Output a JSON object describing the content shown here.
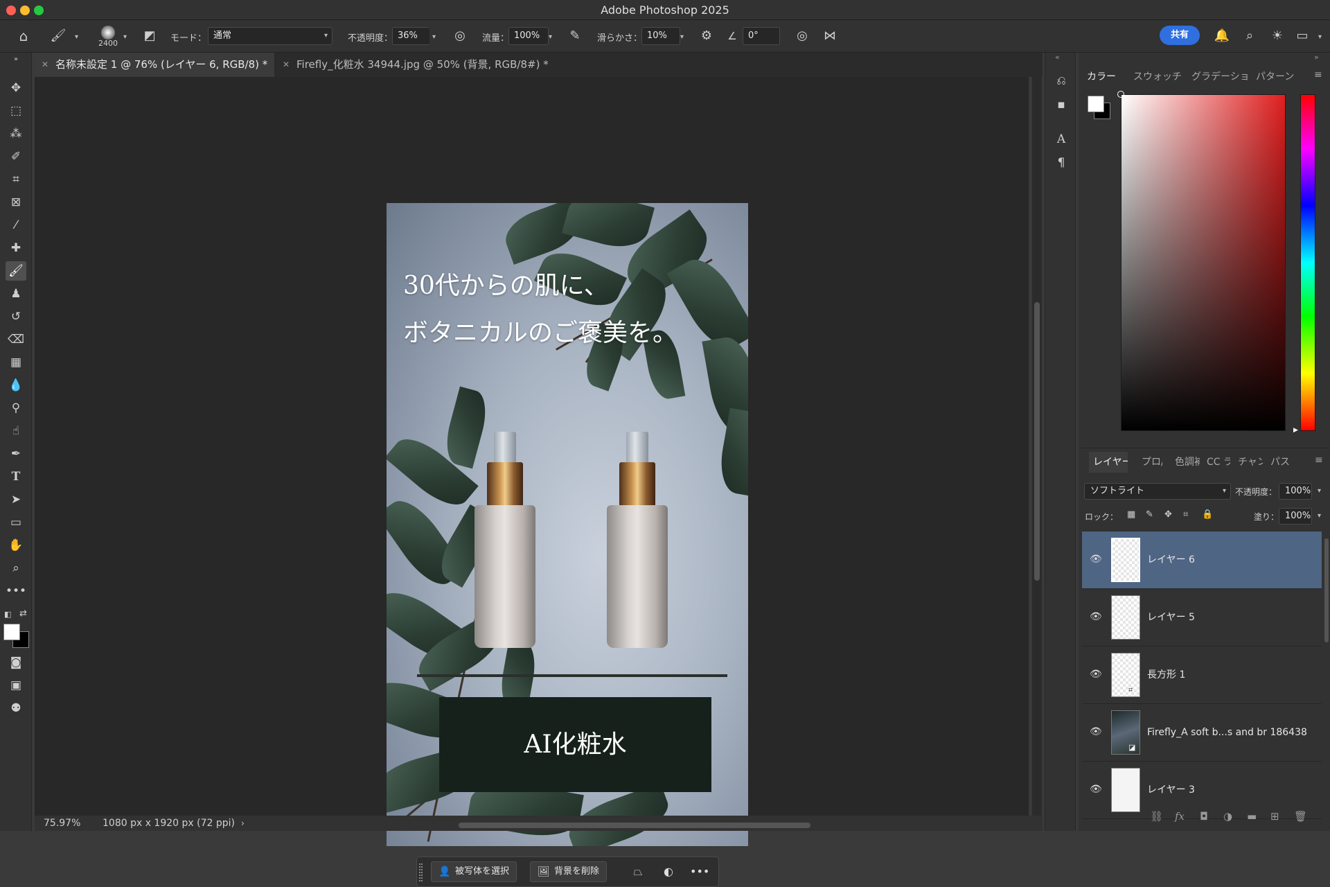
{
  "window": {
    "title": "Adobe Photoshop 2025"
  },
  "options": {
    "brush_size": "2400",
    "mode_label": "モード：",
    "mode_value": "通常",
    "opacity_label": "不透明度：",
    "opacity_value": "36%",
    "flow_label": "流量：",
    "flow_value": "100%",
    "smoothing_label": "滑らかさ：",
    "smoothing_value": "10%",
    "angle_value": "0°",
    "share_label": "共有"
  },
  "tabs": [
    {
      "label": "名称未設定 1 @ 76% (レイヤー 6, RGB/8) *"
    },
    {
      "label": "Firefly_化粧水 34944.jpg @ 50% (背景, RGB/8#) *"
    }
  ],
  "canvas": {
    "headline_line1": "30代からの肌に、",
    "headline_line2": "ボタニカルのご褒美を。",
    "product_name": "AI化粧水"
  },
  "context_bar": {
    "select_subject": "被写体を選択",
    "remove_background": "背景を削除"
  },
  "status": {
    "zoom": "75.97%",
    "doc_info": "1080 px x 1920 px (72 ppi)"
  },
  "color_panel": {
    "tabs": [
      "カラー",
      "スウォッチ",
      "グラデーショ",
      "パターン"
    ]
  },
  "layers_panel": {
    "tabs": [
      "レイヤー",
      "プロ/",
      "色調補",
      "CC ラ",
      "チャン",
      "パス"
    ],
    "blend_mode": "ソフトライト",
    "opacity_label": "不透明度：",
    "opacity_value": "100%",
    "lock_label": "ロック：",
    "fill_label": "塗り：",
    "fill_value": "100%",
    "layers": [
      {
        "name": "レイヤー 6"
      },
      {
        "name": "レイヤー 5"
      },
      {
        "name": "長方形 1"
      },
      {
        "name": "Firefly_A soft b...s and br 186438"
      },
      {
        "name": "レイヤー 3"
      }
    ]
  },
  "icons": [
    "home-icon",
    "brush-icon",
    "airbrush-icon",
    "gear-icon",
    "bell-icon",
    "search-icon",
    "lightbulb-icon",
    "workspace-icon",
    "eye-icon",
    "link-icon",
    "fx-icon",
    "mask-icon",
    "adjustment-icon",
    "folder-icon",
    "new-layer-icon",
    "trash-icon"
  ],
  "colors": {
    "accent": "#2f6fe0",
    "layer_selected": "#4f6584",
    "foreground": "#ffffff",
    "background": "#000000"
  }
}
